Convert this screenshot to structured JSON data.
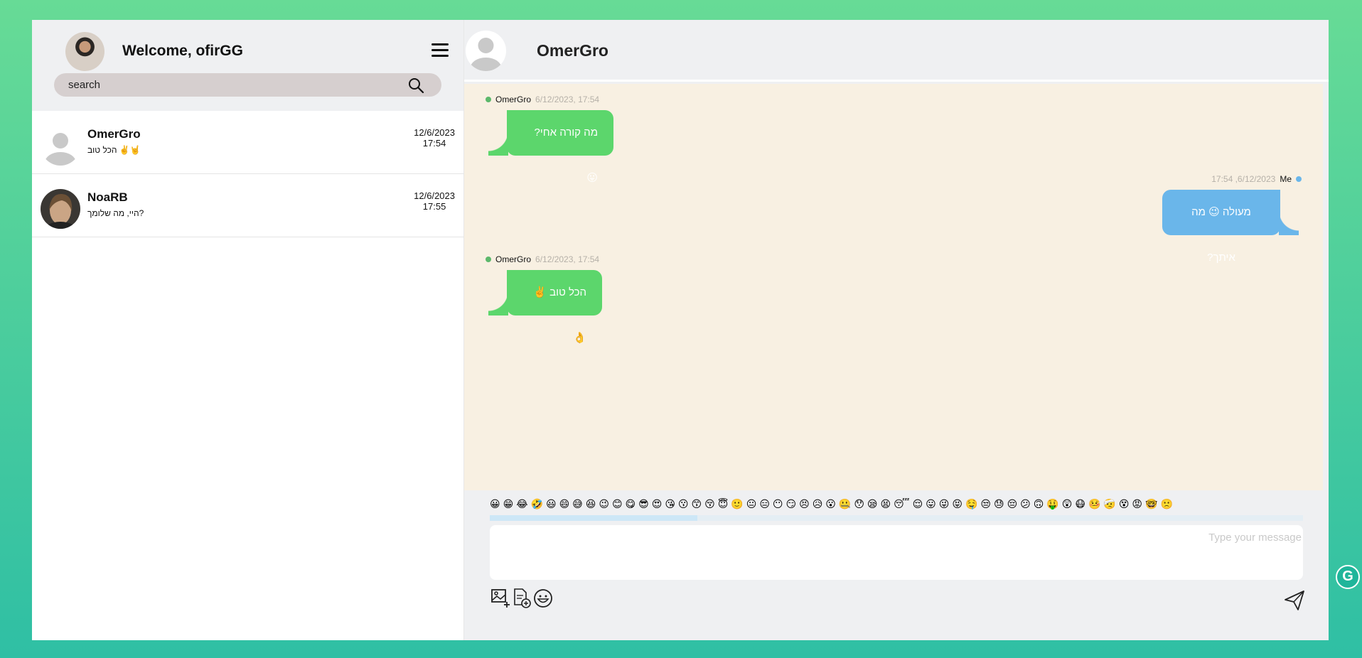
{
  "user": {
    "welcome": "Welcome, ofirGG"
  },
  "search": {
    "placeholder": "search"
  },
  "contacts": [
    {
      "name": "OmerGro",
      "preview": "הכל טוב ✌️🤘",
      "date": "12/6/2023",
      "time": "17:54"
    },
    {
      "name": "NoaRB",
      "preview": "היי, מה שלומך?",
      "date": "12/6/2023",
      "time": "17:55"
    }
  ],
  "chat": {
    "title": "OmerGro",
    "messages": [
      {
        "sender": "OmerGro",
        "time": "6/12/2023, 17:54",
        "text": "מה קורה אחי? 😛"
      },
      {
        "sender": "Me",
        "time": "17:54 ,6/12/2023",
        "text": "מעולה 😉 מה איתך?"
      },
      {
        "sender": "OmerGro",
        "time": "6/12/2023, 17:54",
        "text": "הכל טוב ✌️👌"
      }
    ]
  },
  "composer": {
    "placeholder": "Type your message",
    "emojis": "😀😁😂🤣😃😄😅😆😉😊😋😎😍😘😗😙😚😇🙂😐😑😶😏😣😥😮🤐😯😪😫😴😌😛😜😝🤤😒😓😔😕🙃🤑😲😷🤒🤕😵😡🤓🙁"
  },
  "colors": {
    "incoming": "#5cd66c",
    "outgoing": "#6ab6ea",
    "chat_bg": "#f8f0e2"
  }
}
